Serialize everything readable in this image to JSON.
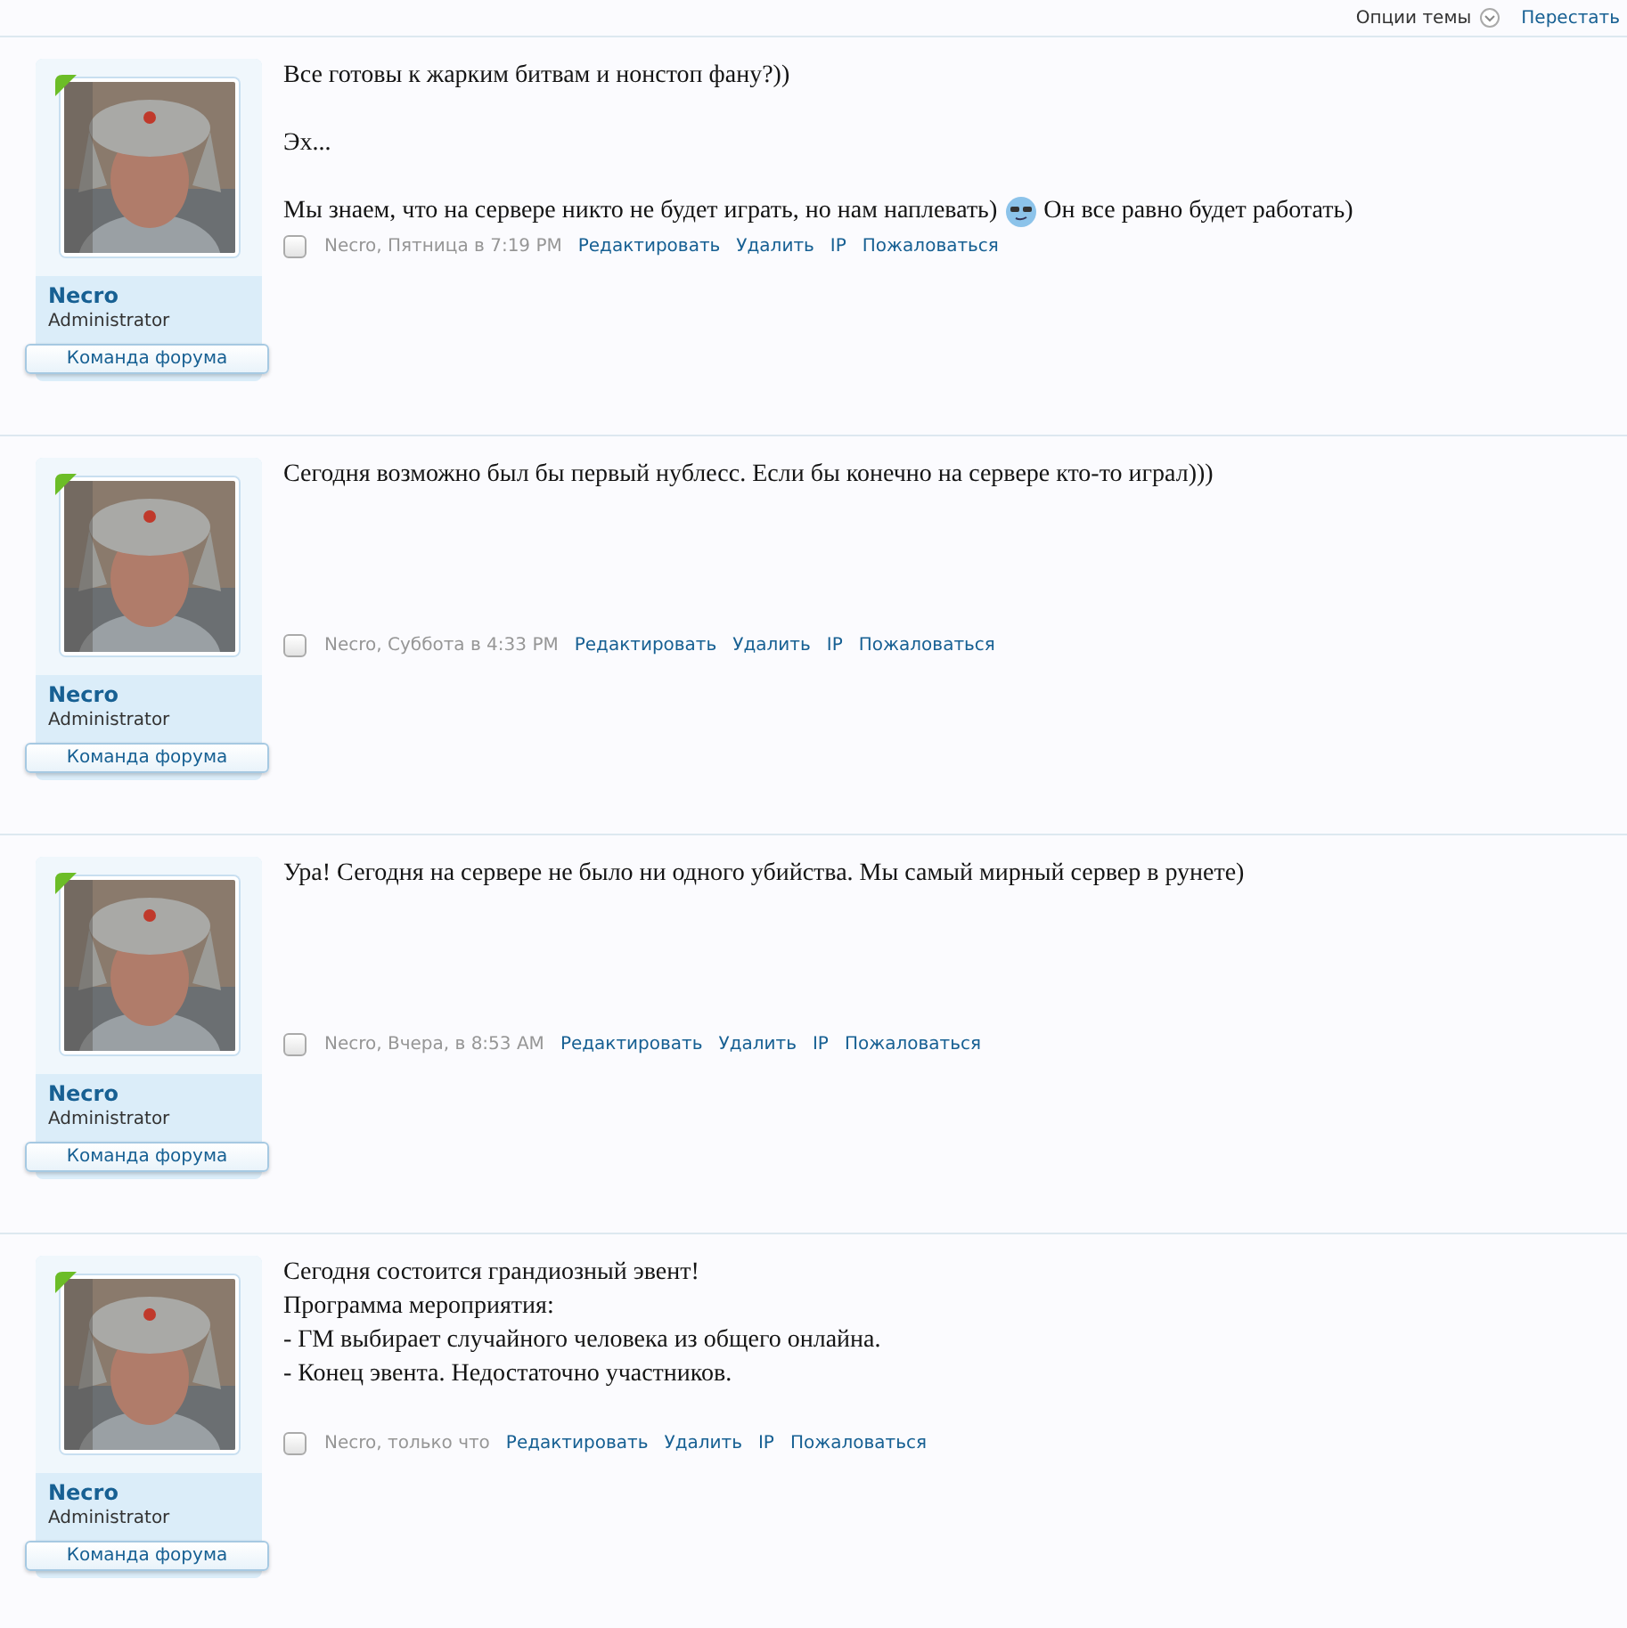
{
  "topbar": {
    "thread_options": "Опции темы",
    "unwatch": "Перестать"
  },
  "posts": [
    {
      "author": "Necro",
      "role": "Administrator",
      "team": "Команда форума",
      "spaced": true,
      "lines": [
        {
          "text": "Все готовы к жарким битвам и нонстоп фану?))",
          "emoticon": false
        },
        {
          "text": "Эх...",
          "emoticon": false
        },
        {
          "text": "Мы знаем, что на сервере никто не будет играть, но нам наплевать)",
          "emoticon": true,
          "after": "Он все равно будет работать)"
        }
      ],
      "meta": "Necro, Пятница в 7:19 PM",
      "checked": false,
      "links": [
        "Редактировать",
        "Удалить",
        "IP",
        "Пожаловаться"
      ]
    },
    {
      "author": "Necro",
      "role": "Administrator",
      "team": "Команда форума",
      "lines": [
        {
          "text": "Сегодня возможно был бы первый нублесс. Если бы конечно на сервере кто-то играл)))",
          "emoticon": false
        }
      ],
      "meta": "Necro, Суббота в 4:33 PM",
      "checked": false,
      "links": [
        "Редактировать",
        "Удалить",
        "IP",
        "Пожаловаться"
      ]
    },
    {
      "author": "Necro",
      "role": "Administrator",
      "team": "Команда форума",
      "lines": [
        {
          "text": "Ура! Сегодня на сервере не было ни одного убийства. Мы самый мирный сервер в рунете)",
          "emoticon": false
        }
      ],
      "meta": "Necro, Вчера, в 8:53 AM",
      "checked": false,
      "links": [
        "Редактировать",
        "Удалить",
        "IP",
        "Пожаловаться"
      ]
    },
    {
      "author": "Necro",
      "role": "Administrator",
      "team": "Команда форума",
      "spaced": false,
      "lines": [
        {
          "text": "Сегодня состоится грандиозный эвент!",
          "emoticon": false
        },
        {
          "text": "Программа мероприятия:",
          "emoticon": false
        },
        {
          "text": "- ГМ выбирает случайного человека из общего онлайна.",
          "emoticon": false
        },
        {
          "text": "- Конец эвента. Недостаточно участников.",
          "emoticon": false
        }
      ],
      "meta": "Necro, только что",
      "checked": false,
      "links": [
        "Редактировать",
        "Удалить",
        "IP",
        "Пожаловаться"
      ]
    }
  ]
}
